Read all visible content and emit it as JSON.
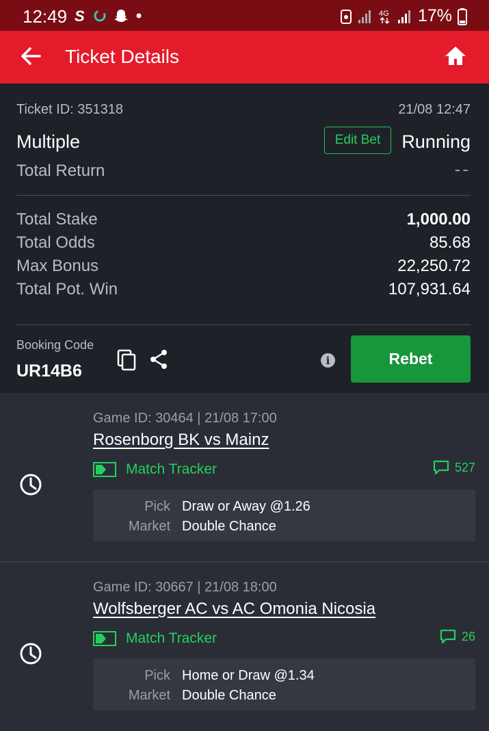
{
  "status_bar": {
    "time": "12:49",
    "battery_pct": "17%",
    "network": "4G"
  },
  "header": {
    "title": "Ticket Details",
    "bg_color": "#e41b2a"
  },
  "ticket": {
    "id_label": "Ticket ID: 351318",
    "date": "21/08 12:47",
    "type": "Multiple",
    "edit_bet_label": "Edit Bet",
    "status": "Running",
    "total_return_label": "Total Return",
    "total_return_value": "--",
    "rows": [
      {
        "label": "Total Stake",
        "value": "1,000.00"
      },
      {
        "label": "Total Odds",
        "value": "85.68"
      },
      {
        "label": "Max Bonus",
        "value": "22,250.72"
      },
      {
        "label": "Total Pot. Win",
        "value": "107,931.64"
      }
    ],
    "booking_label": "Booking Code",
    "booking_code": "UR14B6",
    "rebet_label": "Rebet",
    "accent_green": "#17963b"
  },
  "selections": [
    {
      "game_meta": "Game ID: 30464 | 21/08 17:00",
      "match": "Rosenborg BK vs Mainz",
      "tracker_label": "Match Tracker",
      "comment_count": "527",
      "pick_label": "Pick",
      "pick_value": "Draw or Away @1.26",
      "market_label": "Market",
      "market_value": "Double Chance"
    },
    {
      "game_meta": "Game ID: 30667 | 21/08 18:00",
      "match": "Wolfsberger AC vs AC Omonia Nicosia",
      "tracker_label": "Match Tracker",
      "comment_count": "26",
      "pick_label": "Pick",
      "pick_value": "Home or Draw @1.34",
      "market_label": "Market",
      "market_value": "Double Chance"
    }
  ]
}
